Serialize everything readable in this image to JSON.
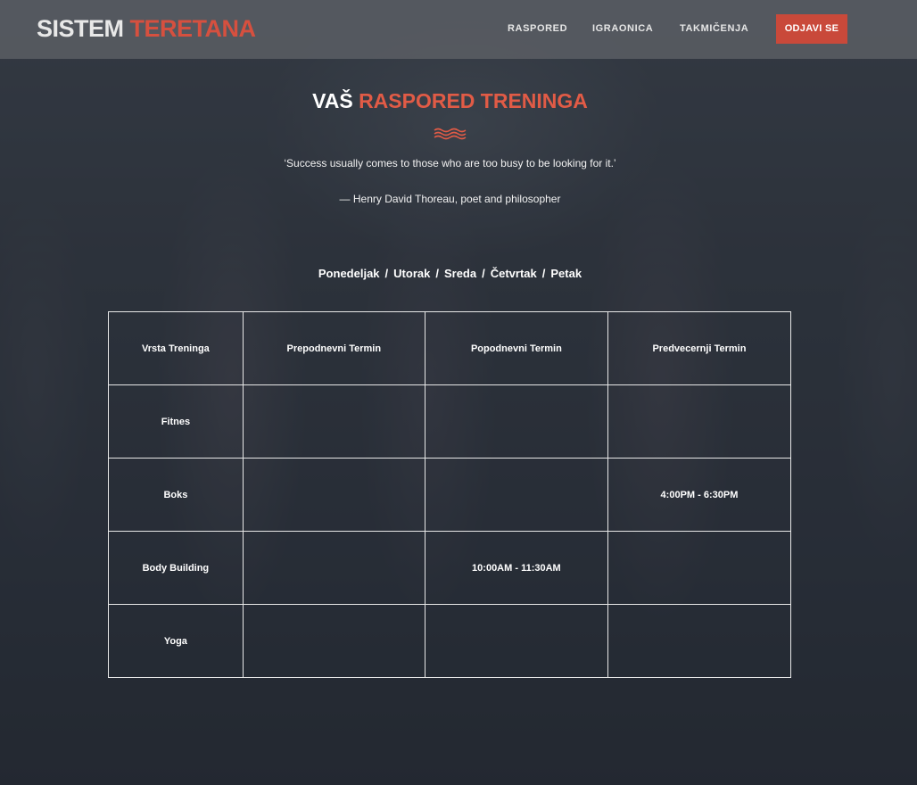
{
  "header": {
    "brand_part1": "SISTEM",
    "brand_part2": "TERETANA",
    "nav": [
      {
        "label": "RASPORED"
      },
      {
        "label": "IGRAONICA"
      },
      {
        "label": "TAKMIČENJA"
      }
    ],
    "logout_label": "ODJAVI SE"
  },
  "main": {
    "title_part1": "VAŠ",
    "title_part2": "RASPORED TRENINGA",
    "divider_icon": "wave-icon",
    "quote": "‘Success usually comes to those who are too busy to be looking for it.’",
    "author": "— Henry David Thoreau, poet and philosopher",
    "days": [
      "Ponedeljak",
      "Utorak",
      "Sreda",
      "Četvrtak",
      "Petak"
    ],
    "day_separator": "/"
  },
  "schedule": {
    "headers": [
      "Vrsta Treninga",
      "Prepodnevni Termin",
      "Popodnevni Termin",
      "Predvecernji Termin"
    ],
    "rows": [
      {
        "type": "Fitnes",
        "morning": "",
        "afternoon": "",
        "evening": ""
      },
      {
        "type": "Boks",
        "morning": "",
        "afternoon": "",
        "evening": "4:00PM - 6:30PM"
      },
      {
        "type": "Body Building",
        "morning": "",
        "afternoon": "10:00AM - 11:30AM",
        "evening": ""
      },
      {
        "type": "Yoga",
        "morning": "",
        "afternoon": "",
        "evening": ""
      }
    ]
  },
  "colors": {
    "accent": "#e15b46",
    "button": "#c9493a",
    "header_bg": "#5a5e64"
  }
}
